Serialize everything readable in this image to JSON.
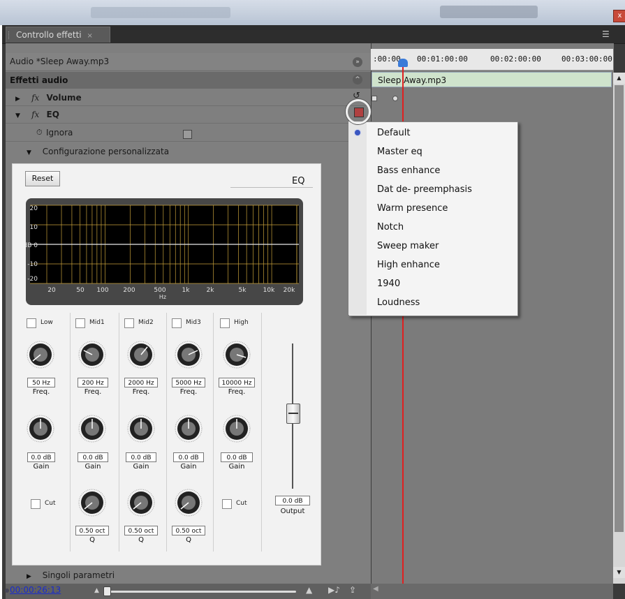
{
  "window": {
    "close_label": "x"
  },
  "panel": {
    "tab_label": "Controllo effetti",
    "tab_close": "×",
    "menu_icon": "panel-menu-icon"
  },
  "rows": {
    "audio": "Audio *Sleep Away.mp3",
    "effetti": "Effetti audio",
    "volume": "Volume",
    "eq": "EQ",
    "ignora": "Ignora",
    "config": "Configurazione personalizzata",
    "singoli": "Singoli parametri",
    "fx_symbol": "fx"
  },
  "eq": {
    "reset": "Reset",
    "title": "EQ",
    "graph": {
      "y_labels": [
        "20",
        "10",
        "dB 0",
        "-10",
        "-20"
      ],
      "x_labels": [
        "20",
        "50",
        "100",
        "200",
        "500",
        "1k",
        "2k",
        "5k",
        "10k",
        "20k"
      ],
      "x_unit": "Hz"
    },
    "bands": [
      {
        "name": "Low",
        "freq": "50 Hz",
        "gain": "0.0 dB",
        "cut_label": "Cut"
      },
      {
        "name": "Mid1",
        "freq": "200 Hz",
        "gain": "0.0 dB",
        "q": "0.50 oct"
      },
      {
        "name": "Mid2",
        "freq": "2000 Hz",
        "gain": "0.0 dB",
        "q": "0.50 oct"
      },
      {
        "name": "Mid3",
        "freq": "5000 Hz",
        "gain": "0.0 dB",
        "q": "0.50 oct"
      },
      {
        "name": "High",
        "freq": "10000 Hz",
        "gain": "0.0 dB",
        "cut_label": "Cut"
      }
    ],
    "labels": {
      "freq": "Freq.",
      "gain": "Gain",
      "q": "Q"
    },
    "output": {
      "value": "0.0 dB",
      "label": "Output"
    }
  },
  "timeline": {
    "ruler": [
      ":00:00",
      "00:01:00:00",
      "00:02:00:00",
      "00:03:00:00"
    ],
    "clip_name": "Sleep Away.mp3",
    "playhead_color": "#e02020"
  },
  "dropdown": {
    "items": [
      "Default",
      "Master eq",
      "Bass enhance",
      "Dat de- preemphasis",
      "Warm presence",
      "Notch",
      "Sweep maker",
      "High enhance",
      "1940",
      "Loudness"
    ],
    "selected": "Default"
  },
  "bottom": {
    "timecode": "00:00:26:13"
  },
  "colors": {
    "panel_bg": "#7f7f7f",
    "eq_box": "#f2f2f2",
    "graph_bg": "#000000",
    "graph_grid": "#c8a23a",
    "clip_bg": "#cfe3cc"
  }
}
